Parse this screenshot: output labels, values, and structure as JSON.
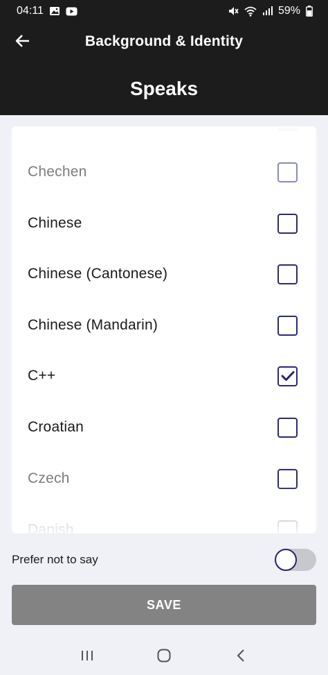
{
  "status_bar": {
    "time": "04:11",
    "battery": "59%",
    "icons": [
      "gallery-icon",
      "youtube-icon",
      "mute-icon",
      "wifi-icon",
      "signal-icon",
      "battery-icon"
    ]
  },
  "header": {
    "title": "Background & Identity",
    "page_title": "Speaks",
    "back_icon": "arrow-left-icon",
    "background_color": "#1c1c1c"
  },
  "languages": [
    {
      "label": "Chechen",
      "checked": false
    },
    {
      "label": "Chinese",
      "checked": false
    },
    {
      "label": "Chinese (Cantonese)",
      "checked": false
    },
    {
      "label": "Chinese (Mandarin)",
      "checked": false
    },
    {
      "label": "C++",
      "checked": true
    },
    {
      "label": "Croatian",
      "checked": false
    },
    {
      "label": "Czech",
      "checked": false
    },
    {
      "label": "Danish",
      "checked": false
    }
  ],
  "prefer_not_to_say": {
    "label": "Prefer not to say",
    "enabled": false
  },
  "save_button": {
    "label": "SAVE",
    "color": "#838383"
  },
  "colors": {
    "accent": "#2a2a7c",
    "page_background": "#f0f1f6"
  },
  "nav_bar": {
    "icons": [
      "recent-apps-icon",
      "home-icon",
      "back-icon"
    ]
  }
}
